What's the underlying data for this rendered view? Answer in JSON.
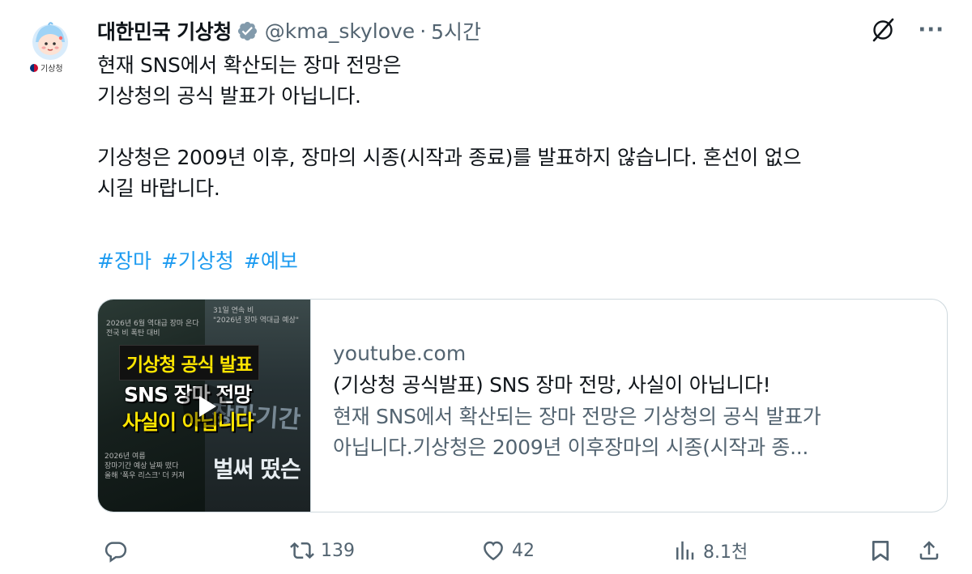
{
  "account": {
    "display_name": "대한민국 기상청",
    "handle": "@kma_skylove",
    "separator": "·",
    "time": "5시간",
    "avatar_tag": "기상청"
  },
  "tweet": {
    "line1": "현재 SNS에서 확산되는 장마 전망은",
    "line2": "기상청의 공식 발표가 아닙니다.",
    "line3": "기상청은 2009년 이후, 장마의 시종(시작과 종료)를 발표하지 않습니다. 혼선이 없으",
    "line4": "시길 바랍니다.",
    "hashtags": [
      "#장마",
      "#기상청",
      "#예보"
    ]
  },
  "card": {
    "domain": "youtube.com",
    "title": "(기상청 공식발표) SNS 장마 전망, 사실이 아닙니다!",
    "desc_line1": "현재 SNS에서 확산되는 장마 전망은 기상청의 공식 발표가",
    "desc_line2": "아닙니다.기상청은 2009년 이후장마의 시종(시작과 종...",
    "thumbnail": {
      "badge": "기상청 공식 발표",
      "headline1": "SNS 장마 전망",
      "headline2": "사실이 아닙니다",
      "side_text1": "장마기간",
      "side_text2": "벌써 떴슨",
      "faint_top_left": "2026년 6월 역대급 장마 온다\n전국 비 폭탄 대비",
      "faint_top_right": "31일 연속 비\n\"2026년 장마 역대급 예상\"",
      "faint_bottom_left": "2026년 여름\n장마기간 예상 날짜 떴다\n올해 '폭우 리스크' 더 커져"
    }
  },
  "actions": {
    "reply_count": "",
    "retweet_count": "139",
    "like_count": "42",
    "view_count": "8.1천"
  },
  "colors": {
    "link": "#1d9bf0",
    "muted": "#536471",
    "text": "#0f1419",
    "verified": "#829aab",
    "border": "#cfd9de"
  }
}
